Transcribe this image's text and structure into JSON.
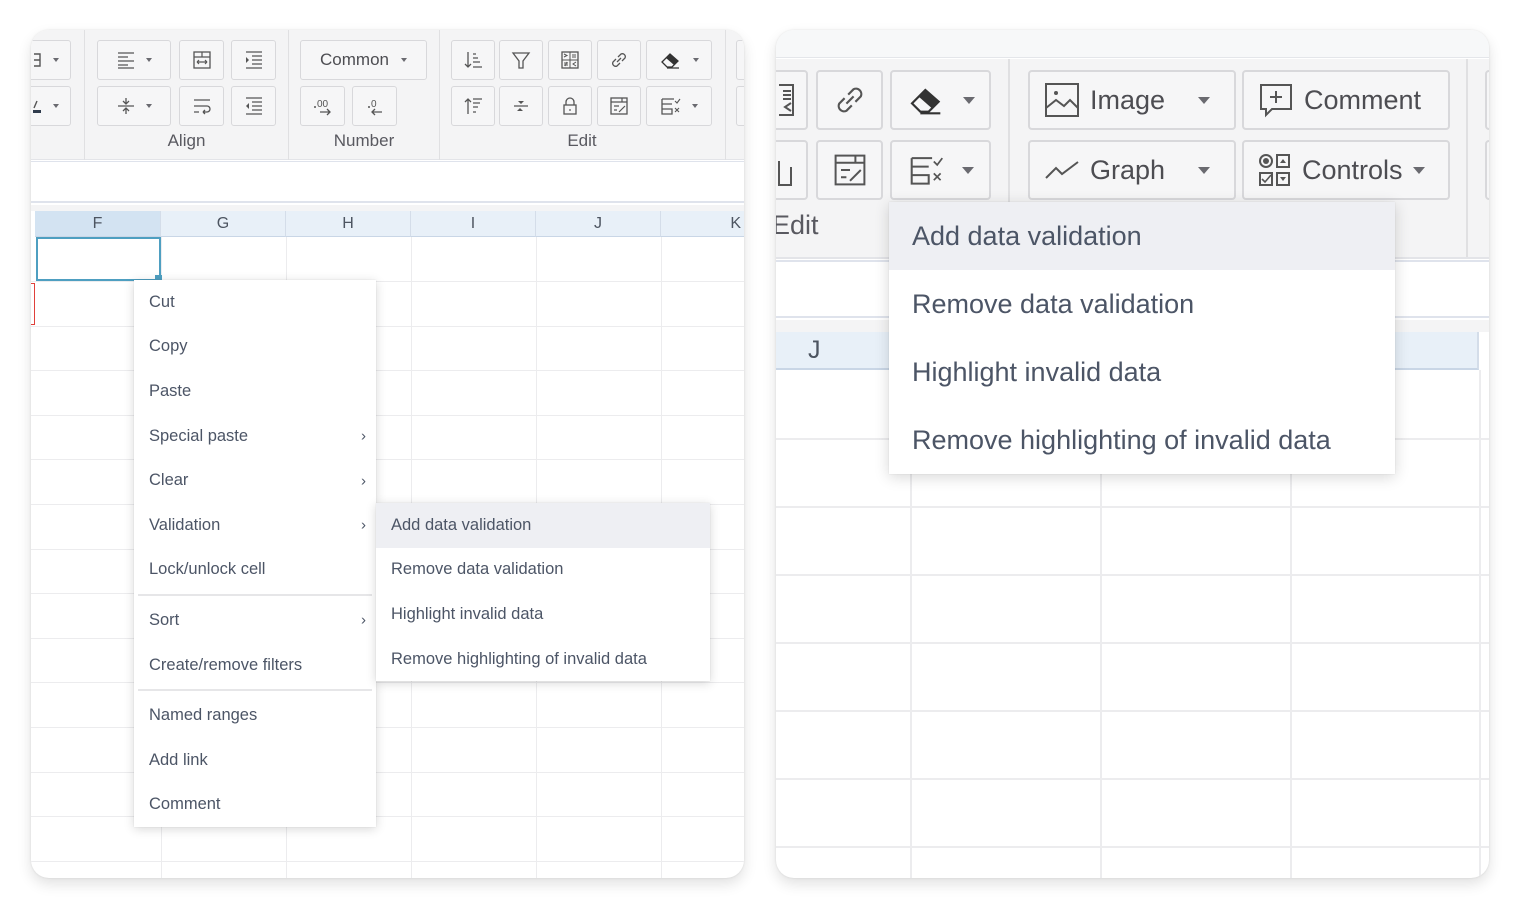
{
  "left_panel": {
    "ribbon": {
      "groups": [
        {
          "label": "Align"
        },
        {
          "label": "Number"
        },
        {
          "label": "Edit"
        }
      ],
      "number_format_select": "Common"
    },
    "column_headers": [
      "F",
      "G",
      "H",
      "I",
      "J",
      "K"
    ],
    "selected_column": "F",
    "context_menu": {
      "items": [
        {
          "label": "Cut",
          "has_submenu": false
        },
        {
          "label": "Copy",
          "has_submenu": false
        },
        {
          "label": "Paste",
          "has_submenu": false
        },
        {
          "label": "Special paste",
          "has_submenu": true
        },
        {
          "label": "Clear",
          "has_submenu": true
        },
        {
          "label": "Validation",
          "has_submenu": true
        },
        {
          "label": "Lock/unlock cell",
          "has_submenu": false
        },
        {
          "label": "Sort",
          "has_submenu": true
        },
        {
          "label": "Create/remove filters",
          "has_submenu": false
        },
        {
          "label": "Named ranges",
          "has_submenu": false
        },
        {
          "label": "Add link",
          "has_submenu": false
        },
        {
          "label": "Comment",
          "has_submenu": false
        }
      ],
      "chevron": "›"
    },
    "validation_submenu": {
      "items": [
        {
          "label": "Add data validation",
          "highlighted": true
        },
        {
          "label": "Remove data validation",
          "highlighted": false
        },
        {
          "label": "Highlight invalid data",
          "highlighted": false
        },
        {
          "label": "Remove highlighting of invalid data",
          "highlighted": false
        }
      ]
    }
  },
  "right_panel": {
    "ribbon": {
      "edit_group_label": "Edit",
      "image_button": "Image",
      "graph_button": "Graph",
      "comment_button": "Comment",
      "controls_button": "Controls"
    },
    "column_headers": [
      "J"
    ],
    "validation_dropdown": {
      "items": [
        {
          "label": "Add data validation",
          "highlighted": true
        },
        {
          "label": "Remove data validation",
          "highlighted": false
        },
        {
          "label": "Highlight invalid data",
          "highlighted": false
        },
        {
          "label": "Remove highlighting of invalid data",
          "highlighted": false
        }
      ]
    }
  },
  "colors": {
    "selection_border": "#4e9fc1",
    "header_bg": "#e8f0f8",
    "selected_header_bg": "#d3e3f2",
    "menu_highlight": "#eeeff3",
    "text": "#4c5566"
  }
}
